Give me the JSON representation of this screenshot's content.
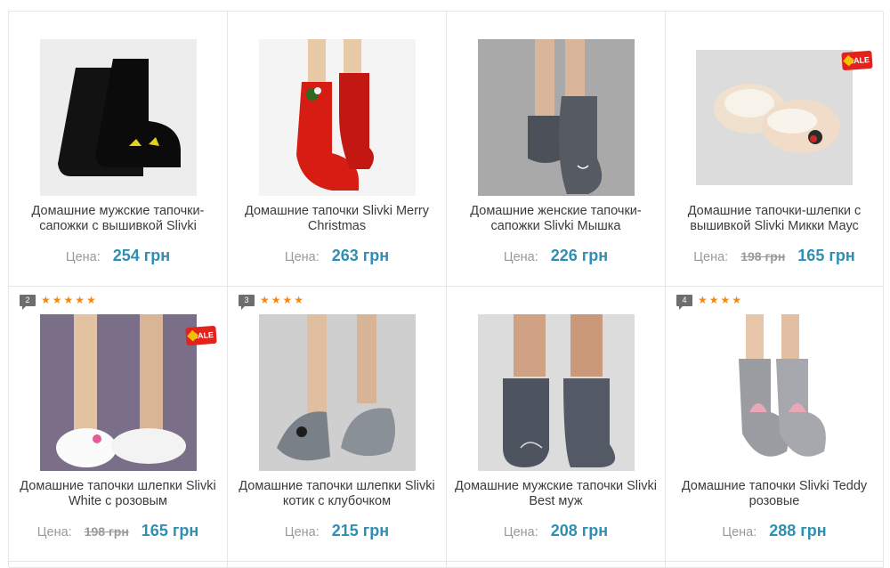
{
  "products": [
    {
      "title": "Домашние мужские тапочки-сапожки с вышивкой Slivki",
      "price_label": "Цена:",
      "price": "254 грн",
      "old_price": "",
      "sale": "",
      "reviews": "",
      "stars": 0,
      "image": "black-boot-slippers"
    },
    {
      "title": "Домашние тапочки Slivki Merry Christmas",
      "price_label": "Цена:",
      "price": "263 грн",
      "old_price": "",
      "sale": "",
      "reviews": "",
      "stars": 0,
      "image": "red-christmas-slipper-socks"
    },
    {
      "title": "Домашние женские тапочки-сапожки Slivki Мышка",
      "price_label": "Цена:",
      "price": "226 грн",
      "old_price": "",
      "sale": "",
      "reviews": "",
      "stars": 0,
      "image": "grey-mouse-boot-slippers"
    },
    {
      "title": "Домашние тапочки-шлепки с вышивкой Slivki Микки Маус",
      "price_label": "Цена:",
      "price": "165 грн",
      "old_price": "198 грн",
      "sale": "SALE",
      "reviews": "",
      "stars": 0,
      "image": "beige-mickey-mouse-slippers"
    },
    {
      "title": "Домашние тапочки шлепки Slivki White с розовым",
      "price_label": "Цена:",
      "price": "165 грн",
      "old_price": "198 грн",
      "sale": "SALE",
      "reviews": "2",
      "stars": 5,
      "image": "white-fluffy-slippers-pink-bow"
    },
    {
      "title": "Домашние тапочки шлепки Slivki котик с клубочком",
      "price_label": "Цена:",
      "price": "215 грн",
      "old_price": "",
      "sale": "",
      "reviews": "3",
      "stars": 4,
      "image": "grey-cat-slippers"
    },
    {
      "title": "Домашние мужские тапочки Slivki Best муж",
      "price_label": "Цена:",
      "price": "208 грн",
      "old_price": "",
      "sale": "",
      "reviews": "",
      "stars": 0,
      "image": "grey-best-boot-slippers"
    },
    {
      "title": "Домашние тапочки Slivki Teddy розовые",
      "price_label": "Цена:",
      "price": "288 грн",
      "old_price": "",
      "sale": "",
      "reviews": "4",
      "stars": 4,
      "image": "grey-teddy-slipper-socks"
    }
  ],
  "colors": {
    "price": "#2f8fb3",
    "star": "#f28a11",
    "sale": "#e2221b",
    "border": "#e6e6e6"
  }
}
